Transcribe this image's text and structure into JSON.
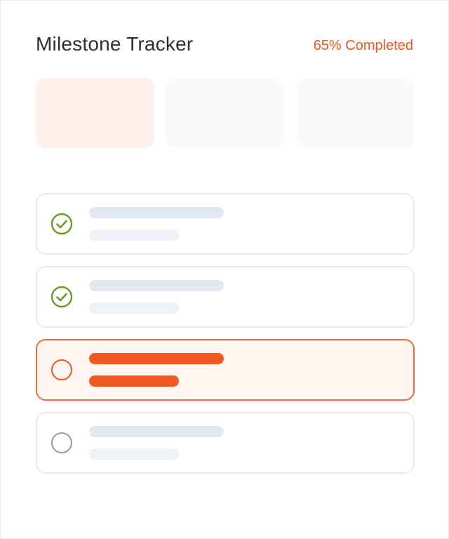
{
  "header": {
    "title": "Milestone Tracker",
    "progress_label": "65% Completed",
    "progress_percent": 65
  },
  "colors": {
    "accent": "#f2571f",
    "done": "#6a9a23",
    "pending_outline": "#9a9a9a",
    "tile_active_bg": "#fff0ec",
    "tile_bg": "#f9fafb",
    "active_item_bg": "#fff5f1",
    "active_item_border": "#ef6a3c",
    "placeholder_strong": "#e3e7ee",
    "placeholder_light": "#eff2f6"
  },
  "summary_tiles": [
    {
      "state": "active"
    },
    {
      "state": "inactive"
    },
    {
      "state": "inactive"
    }
  ],
  "milestones": [
    {
      "status": "completed",
      "status_icon": "check-circle-icon"
    },
    {
      "status": "completed",
      "status_icon": "check-circle-icon"
    },
    {
      "status": "in-progress",
      "status_icon": "circle-outline-icon"
    },
    {
      "status": "pending",
      "status_icon": "circle-outline-icon"
    }
  ]
}
